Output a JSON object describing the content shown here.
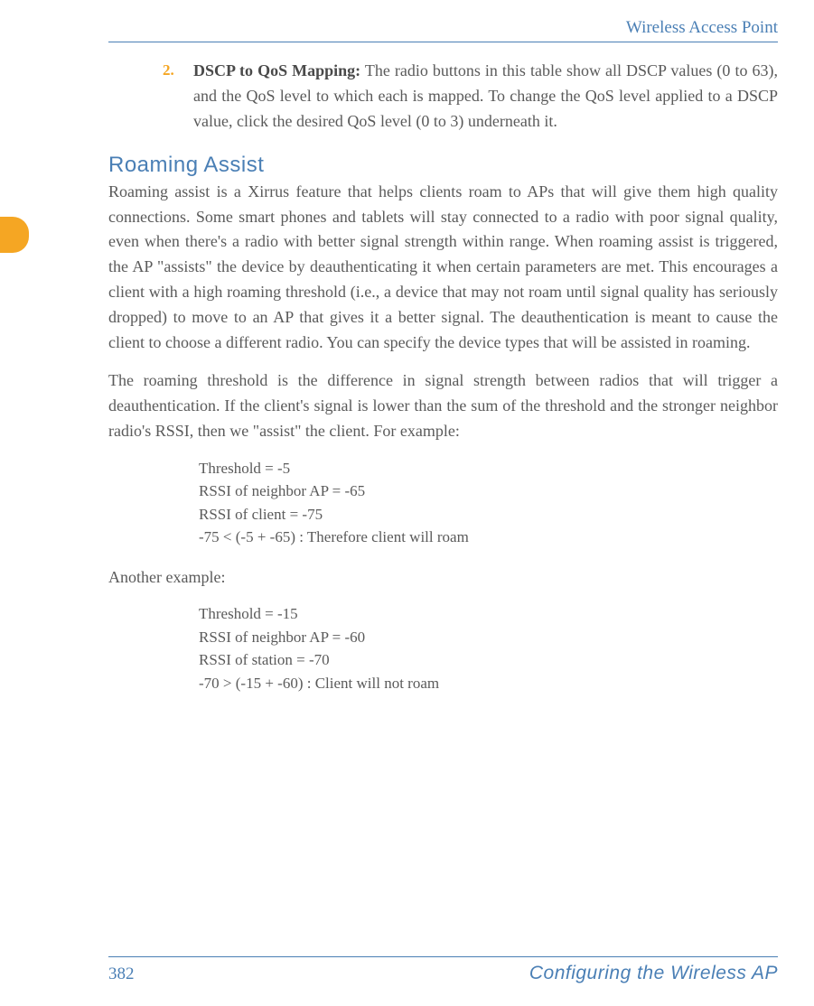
{
  "header": {
    "title": "Wireless Access Point"
  },
  "list": {
    "marker": "2.",
    "bold_prefix": "DSCP to QoS Mapping:",
    "rest": " The radio buttons in this table show all DSCP values (0 to 63), and the QoS level to which each is mapped. To change the QoS level applied to a DSCP value, click the desired QoS level (0 to 3) underneath it."
  },
  "section_heading": "Roaming Assist",
  "para1": "Roaming assist is a Xirrus feature that helps clients roam to APs that will give them high quality connections. Some smart phones and tablets will stay connected to a radio with poor signal quality, even when there's a radio with better signal strength within range. When roaming assist is triggered, the AP \"assists\" the device by deauthenticating it when certain parameters are met. This encourages a client with a high roaming threshold (i.e., a device that may not roam until signal quality has seriously dropped) to move to an AP that gives it a better signal. The deauthentication is meant to cause the client to choose a different radio. You can specify the device types that will be assisted in roaming.",
  "para2": "The roaming threshold is the difference in signal strength between radios that will trigger a deauthentication. If the client's signal is lower than the sum of the threshold and the stronger neighbor radio's RSSI, then we \"assist\" the client. For example:",
  "example1": {
    "l1": "Threshold = -5",
    "l2": "RSSI of neighbor AP = -65",
    "l3": "RSSI of client = -75",
    "l4": "-75 < (-5 + -65) : Therefore client will roam"
  },
  "para3": "Another example:",
  "example2": {
    "l1": "Threshold = -15",
    "l2": "RSSI of neighbor AP = -60",
    "l3": "RSSI of station = -70",
    "l4": "-70 > (-15 + -60) : Client will not roam"
  },
  "footer": {
    "page": "382",
    "section": "Configuring the Wireless AP"
  }
}
